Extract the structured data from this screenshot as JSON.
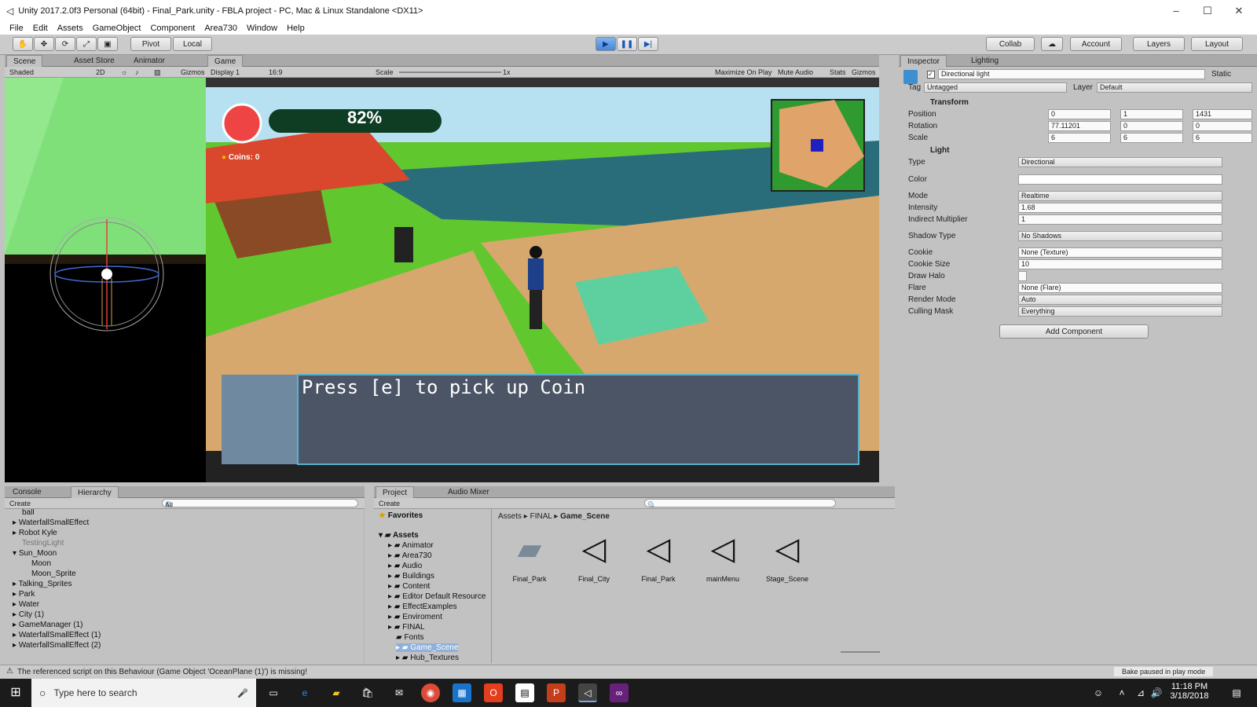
{
  "window": {
    "title": "Unity 2017.2.0f3 Personal (64bit) - Final_Park.unity - FBLA project - PC, Mac & Linux Standalone <DX11>"
  },
  "menu": [
    "File",
    "Edit",
    "Assets",
    "GameObject",
    "Component",
    "Area730",
    "Window",
    "Help"
  ],
  "toolbar": {
    "pivot": "Pivot",
    "local": "Local",
    "collab": "Collab",
    "account": "Account",
    "layers": "Layers",
    "layout": "Layout"
  },
  "scene_panel": {
    "tabs": [
      "Scene",
      "Asset Store",
      "Animator"
    ],
    "shading": "Shaded",
    "mode2d": "2D",
    "gizmos": "Gizmos"
  },
  "game_panel": {
    "tab": "Game",
    "display": "Display 1",
    "aspect": "16:9",
    "scale_label": "Scale",
    "scale_value": "1x",
    "maximize": "Maximize On Play",
    "mute": "Mute Audio",
    "stats": "Stats",
    "gizmos": "Gizmos",
    "hud": {
      "health": "82%",
      "coins": "Coins: 0",
      "dialog": "Press [e] to pick up Coin"
    }
  },
  "inspector": {
    "tabs": [
      "Inspector",
      "Lighting"
    ],
    "object_name": "Directional light",
    "static_label": "Static",
    "tag_label": "Tag",
    "tag_value": "Untagged",
    "layer_label": "Layer",
    "layer_value": "Default",
    "transform": {
      "header": "Transform",
      "position_label": "Position",
      "position": {
        "x": "0",
        "y": "1",
        "z": "1431"
      },
      "rotation_label": "Rotation",
      "rotation": {
        "x": "77.11201",
        "y": "0",
        "z": "0"
      },
      "scale_label": "Scale",
      "scale": {
        "x": "6",
        "y": "6",
        "z": "6"
      }
    },
    "light": {
      "header": "Light",
      "rows": [
        {
          "label": "Type",
          "value": "Directional"
        },
        {
          "label": "Color",
          "value": ""
        },
        {
          "label": "Mode",
          "value": "Realtime"
        },
        {
          "label": "Intensity",
          "value": "1.68"
        },
        {
          "label": "Indirect Multiplier",
          "value": "1"
        },
        {
          "label": "Shadow Type",
          "value": "No Shadows"
        },
        {
          "label": "Cookie",
          "value": "None (Texture)"
        },
        {
          "label": "Cookie Size",
          "value": "10"
        },
        {
          "label": "Draw Halo",
          "value": ""
        },
        {
          "label": "Flare",
          "value": "None (Flare)"
        },
        {
          "label": "Render Mode",
          "value": "Auto"
        },
        {
          "label": "Culling Mask",
          "value": "Everything"
        }
      ]
    },
    "add_component": "Add Component"
  },
  "hierarchy": {
    "tabs": [
      "Console",
      "Hierarchy"
    ],
    "create": "Create",
    "search_placeholder": "All",
    "items": [
      "ball",
      "WaterfallSmallEffect",
      "Robot Kyle",
      "TestingLight",
      "Sun_Moon",
      "Moon",
      "Moon_Sprite",
      "Talking_Sprites",
      "Park",
      "Water",
      "City (1)",
      "GameManager (1)",
      "WaterfallSmallEffect (1)",
      "WaterfallSmallEffect (2)"
    ]
  },
  "project": {
    "tabs": [
      "Project",
      "Audio Mixer"
    ],
    "create": "Create",
    "favorites": "Favorites",
    "assets_root": "Assets",
    "folders": [
      "Animator",
      "Area730",
      "Audio",
      "Buildings",
      "Content",
      "Editor Default Resource",
      "EffectExamples",
      "Enviroment",
      "FINAL",
      "Fonts",
      "Game_Scene",
      "Hub_Textures"
    ],
    "breadcrumb": [
      "Assets",
      "FINAL",
      "Game_Scene"
    ],
    "files": [
      "Final_Park",
      "Final_City",
      "Final_Park",
      "mainMenu",
      "Stage_Scene"
    ]
  },
  "status": {
    "message": "The referenced script on this Behaviour (Game Object 'OceanPlane (1)') is missing!",
    "bake": "Bake paused in play mode"
  },
  "taskbar": {
    "search_placeholder": "Type here to search",
    "time": "11:18 PM",
    "date": "3/18/2018"
  }
}
